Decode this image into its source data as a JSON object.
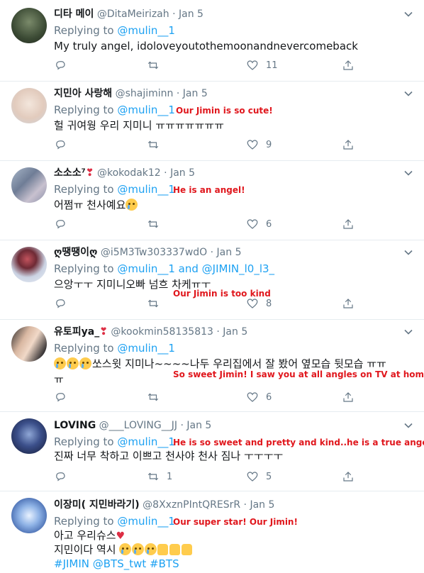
{
  "tweets": [
    {
      "name": "디타 메이",
      "handle": "@DitaMeirizah",
      "date": "Jan 5",
      "replying_prefix": "Replying to",
      "replying_to": "@mulin__1",
      "replying_extra": "",
      "lines": [
        "My truly angel, idoloveyoutothemoonandnevercomeback"
      ],
      "annotation": "",
      "reply_count": "",
      "retweet_count": "",
      "like_count": "11"
    },
    {
      "name": "지민아 사랑해",
      "handle": "@shajiminn",
      "date": "Jan 5",
      "replying_prefix": "Replying to",
      "replying_to": "@mulin__1",
      "replying_extra": "",
      "lines": [
        "헐 귀여웡 우리 지미니 ㅠㅠㅠㅠㅠㅠㅠ"
      ],
      "annotation": "Our Jimin is so cute!",
      "reply_count": "",
      "retweet_count": "",
      "like_count": "9"
    },
    {
      "name": "소소소⁷",
      "handle": "@kokodak12",
      "date": "Jan 5",
      "replying_prefix": "Replying to",
      "replying_to": "@mulin__1",
      "replying_extra": "",
      "lines": [
        "어쩜ㅠ 천사예요"
      ],
      "annotation": "He is an angel!",
      "reply_count": "",
      "retweet_count": "",
      "like_count": "6"
    },
    {
      "name": "ღ땡땡이ღ",
      "handle": "@i5M3Tw303337wdO",
      "date": "Jan 5",
      "replying_prefix": "Replying to",
      "replying_to": "@mulin__1",
      "replying_and": "and",
      "replying_extra": "@JIMIN_l0_l3_",
      "lines": [
        "으앙ㅜㅜ 지미니오빠 넘흐 차케ㅠㅜ"
      ],
      "annotation": "Our Jimin is too kind",
      "reply_count": "",
      "retweet_count": "",
      "like_count": "8"
    },
    {
      "name": "유토피ya_",
      "handle": "@kookmin58135813",
      "date": "Jan 5",
      "replying_prefix": "Replying to",
      "replying_to": "@mulin__1",
      "replying_extra": "",
      "lines": [
        "쏘스윗 지미나~~~~나두 우리집에서 잘 봤어 옆모습 뒷모습 ㅠㅠ",
        "ㅠ"
      ],
      "annotation": "So sweet Jimin! I saw you at all angles on TV at home!",
      "reply_count": "",
      "retweet_count": "",
      "like_count": "6"
    },
    {
      "name": "LOVING",
      "handle": "@___LOVING__JJ",
      "date": "Jan 5",
      "replying_prefix": "Replying to",
      "replying_to": "@mulin__1",
      "replying_extra": "",
      "lines": [
        "진짜 너무 착하고 이쁘고 천사야 천사 짐나 ㅜㅜㅜㅜ"
      ],
      "annotation": "He is so sweet and pretty and kind..he is a true angel",
      "reply_count": "",
      "retweet_count": "1",
      "like_count": "5"
    },
    {
      "name": "이장미( 지민바라기)",
      "handle": "@8XxznPIntQRESrR",
      "date": "Jan 5",
      "replying_prefix": "Replying to",
      "replying_to": "@mulin__1",
      "replying_extra": "",
      "lines": [
        "아고 우리슈스",
        "지민이다 역시"
      ],
      "hashtags": "#JIMIN @BTS_twt #BTS",
      "annotation": "Our super star! Our Jimin!",
      "reply_count": "",
      "retweet_count": "",
      "like_count": ""
    }
  ],
  "icons": {
    "reply": "reply-icon",
    "retweet": "retweet-icon",
    "like": "heart-icon",
    "share": "share-icon",
    "more": "chevron-down-icon"
  },
  "colors": {
    "link": "#1da1f2",
    "annotation": "#e0171d",
    "muted": "#657786"
  }
}
